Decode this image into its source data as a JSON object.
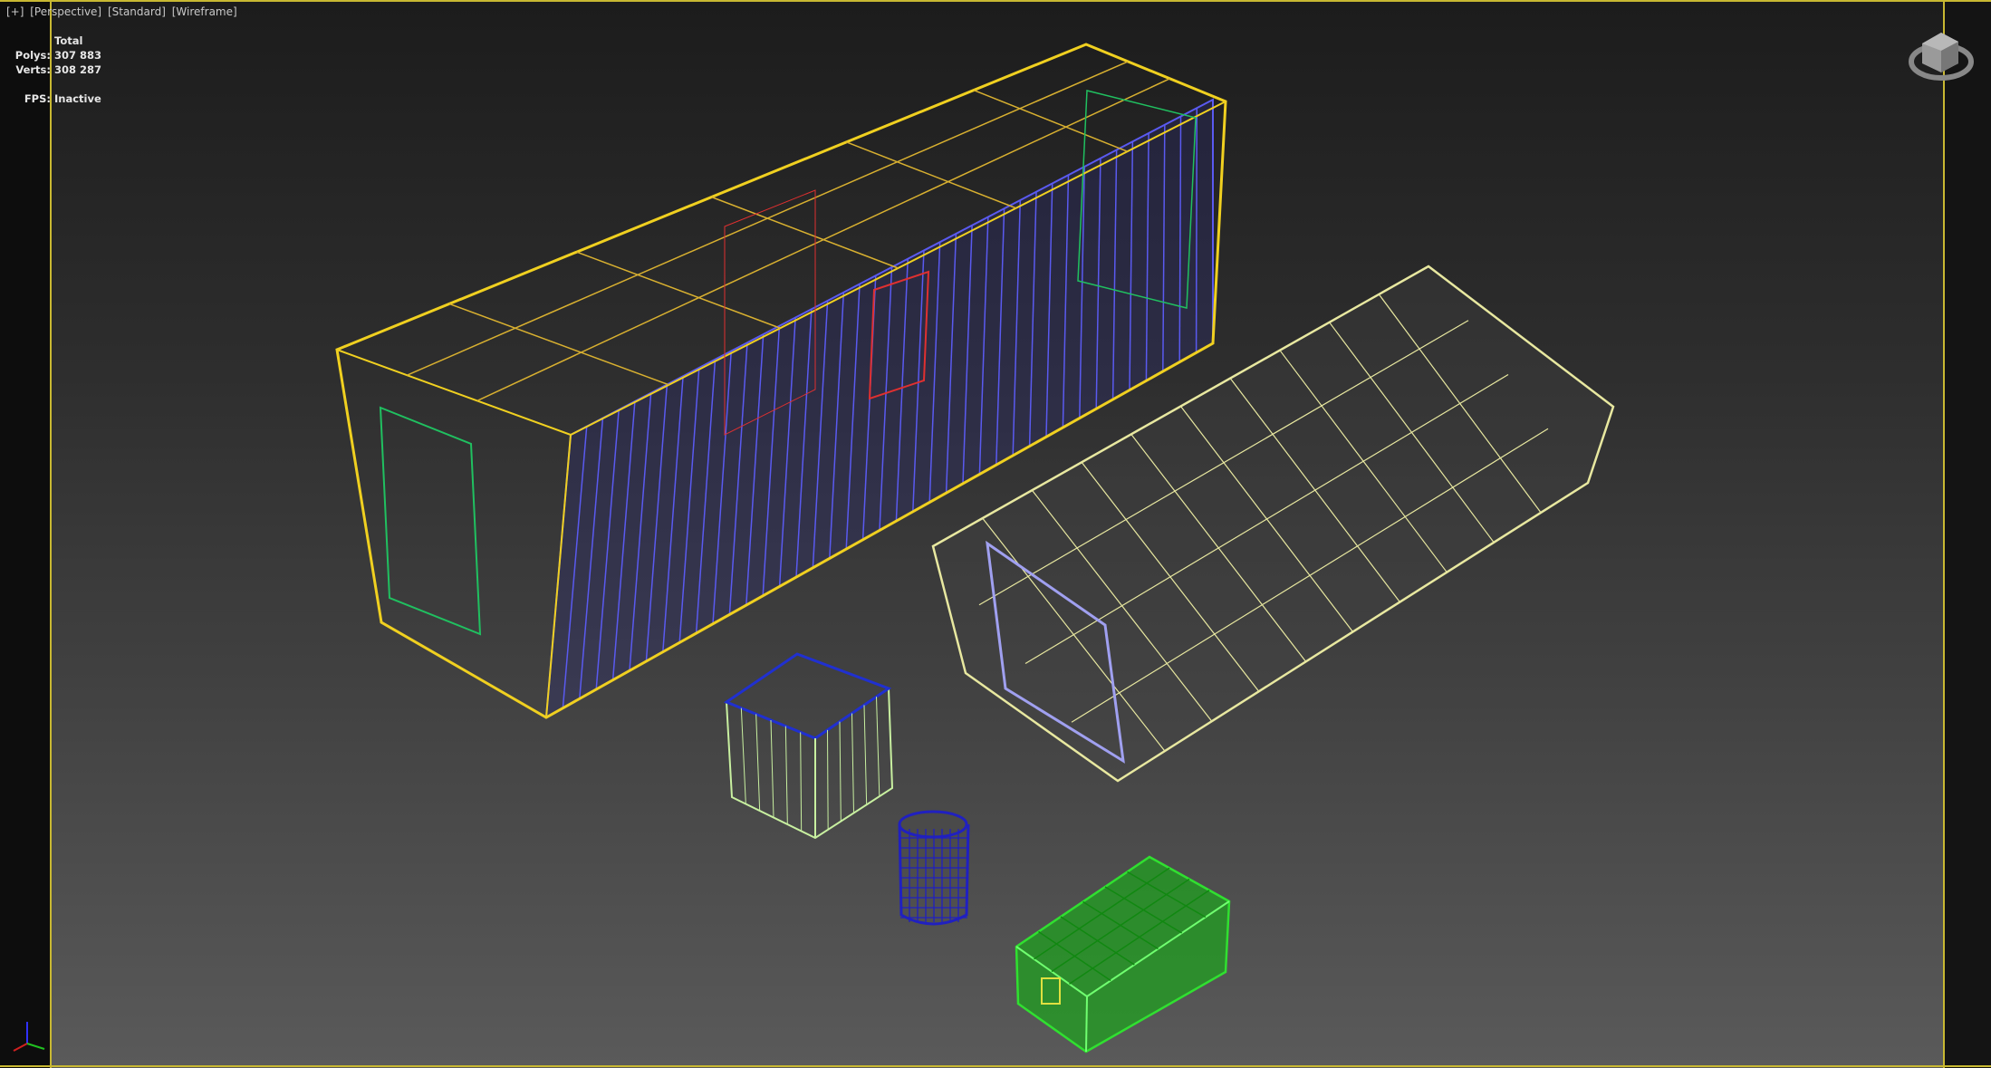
{
  "viewport": {
    "labels": [
      "[+]",
      "[Perspective]",
      "[Standard]",
      "[Wireframe]"
    ]
  },
  "stats": {
    "header": "Total",
    "polys_label": "Polys:",
    "polys_value": "307 883",
    "verts_label": "Verts:",
    "verts_value": "308 287",
    "fps_label": "FPS:",
    "fps_value": "Inactive"
  },
  "colors": {
    "border": "#c8b832",
    "large_container": "#f0d020",
    "large_container_side": "#5050e0",
    "capsule": "#e8e8a0",
    "crate": "#c8f0a0",
    "barrel": "#2020c0",
    "green_case": "#20c020"
  },
  "icons": [
    "viewcube-icon",
    "axis-tripod-icon"
  ]
}
